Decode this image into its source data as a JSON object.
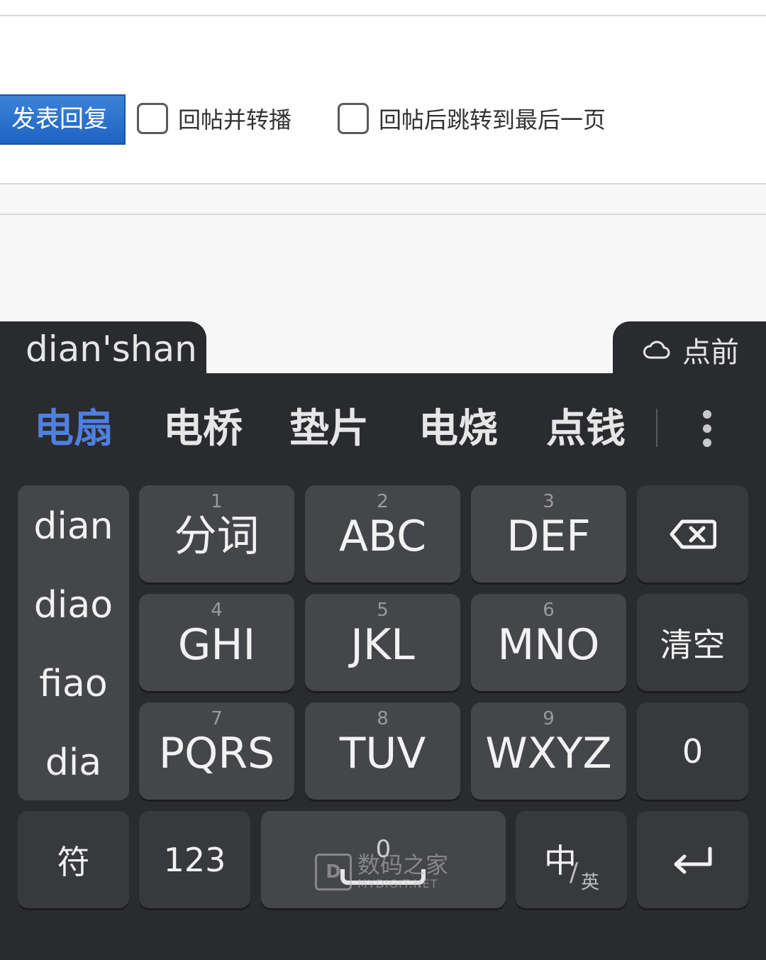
{
  "page": {
    "submit_label": "发表回复",
    "checkbox1_label": "回帖并转播",
    "checkbox2_label": "回帖后跳转到最后一页"
  },
  "ime": {
    "composition": "dian'shan",
    "cloud_text": "点前",
    "candidates": [
      "电扇",
      "电桥",
      "垫片",
      "电烧",
      "点钱"
    ],
    "pinyin_options": [
      "dian",
      "diao",
      "fiao",
      "dia"
    ],
    "keys": [
      {
        "num": "1",
        "label": "分词"
      },
      {
        "num": "2",
        "label": "ABC"
      },
      {
        "num": "3",
        "label": "DEF"
      },
      {
        "num": "4",
        "label": "GHI"
      },
      {
        "num": "5",
        "label": "JKL"
      },
      {
        "num": "6",
        "label": "MNO"
      },
      {
        "num": "7",
        "label": "PQRS"
      },
      {
        "num": "8",
        "label": "TUV"
      },
      {
        "num": "9",
        "label": "WXYZ"
      }
    ],
    "clear_label": "清空",
    "zero_label": "0",
    "symbol_label": "符",
    "numeric_label": "123",
    "space_hint": "0",
    "lang_main": "中",
    "lang_sub": "英",
    "icons": {
      "backspace": "backspace-icon",
      "enter": "enter-icon",
      "cloud": "cloud-icon",
      "more": "more-vertical-icon"
    }
  },
  "watermark": {
    "cn": "数码之家",
    "en": "MYDIGIT.NET",
    "logo": "D"
  }
}
